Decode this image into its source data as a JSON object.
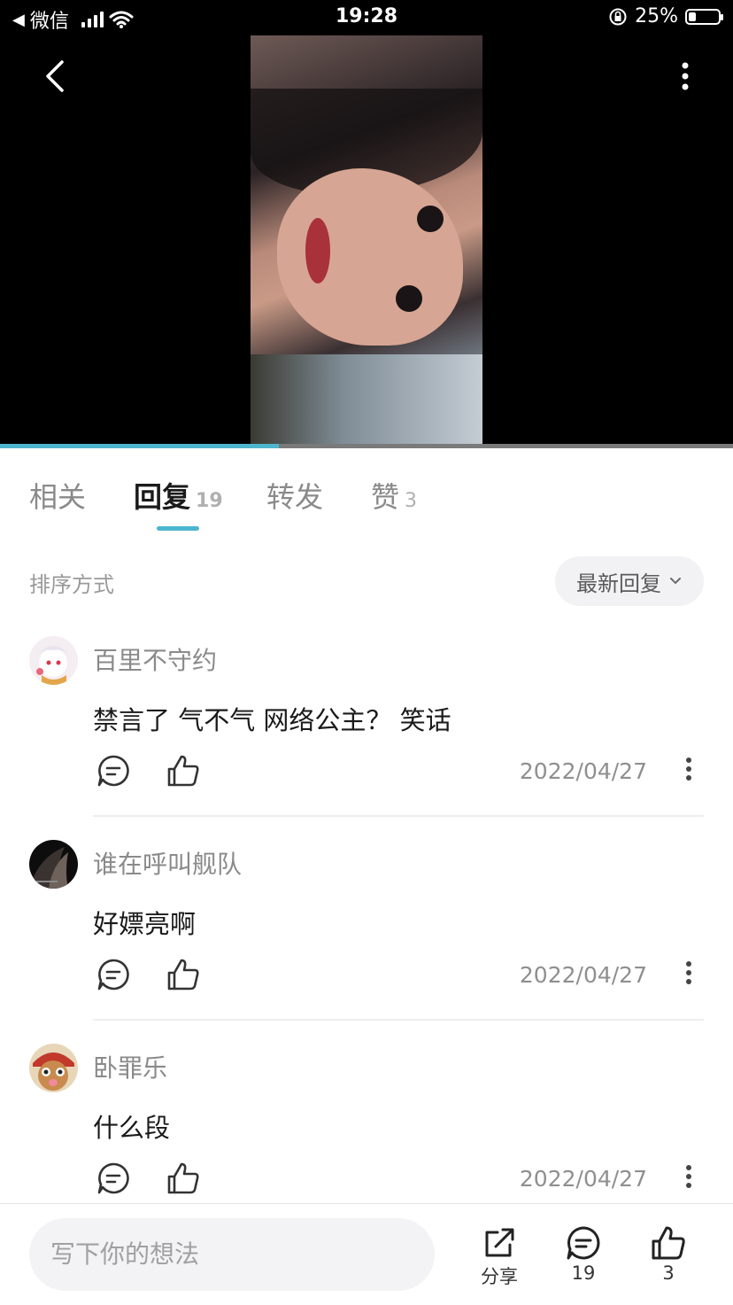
{
  "status_bar": {
    "back_app": "微信",
    "time": "19:28",
    "battery_percent": "25%",
    "battery_level": 0.25
  },
  "video": {
    "progress": 0.38
  },
  "tabs": [
    {
      "label": "相关",
      "count": ""
    },
    {
      "label": "回复",
      "count": "19"
    },
    {
      "label": "转发",
      "count": ""
    },
    {
      "label": "赞",
      "count": "3"
    }
  ],
  "sort": {
    "label": "排序方式",
    "current": "最新回复"
  },
  "comments": [
    {
      "username": "百里不守约",
      "text": "禁言了 气不气 网络公主？ 笑话",
      "date": "2022/04/27"
    },
    {
      "username": "谁在呼叫舰队",
      "text": "好嫖亮啊",
      "date": "2022/04/27"
    },
    {
      "username": "卧罪乐",
      "text": "什么段",
      "date": "2022/04/27"
    }
  ],
  "bottom_bar": {
    "input_placeholder": "写下你的想法",
    "share_label": "分享",
    "reply_count": "19",
    "like_count": "3"
  },
  "colors": {
    "accent": "#4db6ce",
    "video_bg": "#000000"
  },
  "icons": [
    "back-icon",
    "more-vertical-icon",
    "wifi-icon",
    "signal-icon",
    "battery-icon",
    "rotation-lock-icon",
    "reply-icon",
    "like-icon",
    "share-icon",
    "chevron-down-icon"
  ]
}
